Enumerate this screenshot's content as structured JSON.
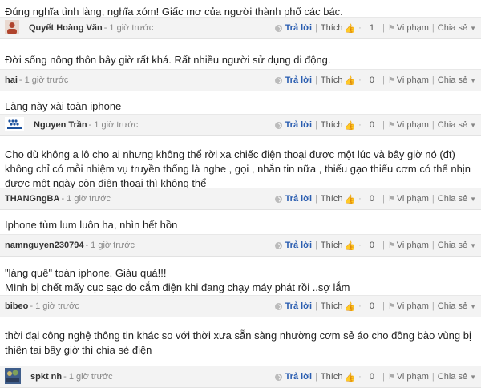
{
  "labels": {
    "reply": "Trả lời",
    "like": "Thích",
    "report": "Vi phạm",
    "share": "Chia sẻ"
  },
  "comments": [
    {
      "text": "Đúng nghĩa tình làng, nghĩa xóm! Giấc mơ của người thành phố các bác.",
      "author": "Quyết Hoàng Văn",
      "time": "- 1 giờ trước",
      "likes": "1",
      "avatar": "person-avatar"
    },
    {
      "text": "Đời sống nông thôn bây giờ rất khá. Rất nhiều người sử dụng di động.",
      "author": "hai",
      "time": "- 1 giờ trước",
      "likes": "0",
      "avatar": ""
    },
    {
      "text": "Làng này xài toàn iphone",
      "author": "Nguyen Trần",
      "time": "- 1 giờ trước",
      "likes": "0",
      "avatar": "blackberry-avatar"
    },
    {
      "text": "Cho dù không a lô cho ai nhưng không thể rời xa chiếc điện thoại được một lúc và bây giờ nó (đt) không chỉ có mỗi nhiệm vụ truyền thống là nghe , gọi , nhắn tin nữa , thiếu gạo thiếu cơm có thể nhịn được một ngày còn điện thoại thì không thể",
      "author": "THANGngBA",
      "time": "- 1 giờ trước",
      "likes": "0",
      "avatar": ""
    },
    {
      "text": "Iphone tùm lum luôn ha, nhìn hết hồn",
      "author": "namnguyen230794",
      "time": "- 1 giờ trước",
      "likes": "0",
      "avatar": ""
    },
    {
      "text": "\"làng quê\" toàn iphone. Giàu quá!!!\nMình bị chết mấy cục sạc do cắm điện khi đang chạy máy phát rồi ..sợ lắm",
      "author": "bibeo",
      "time": "- 1 giờ trước",
      "likes": "0",
      "avatar": ""
    },
    {
      "text": "thời đại công nghệ thông tin khác so với thời xưa sẵn sàng nhường cơm sẻ áo cho đồng bào vùng bị thiên tai bây giờ thì chia sẻ điện",
      "author": "spkt nh",
      "time": "- 1 giờ trước",
      "likes": "0",
      "avatar": "photo-avatar"
    }
  ]
}
